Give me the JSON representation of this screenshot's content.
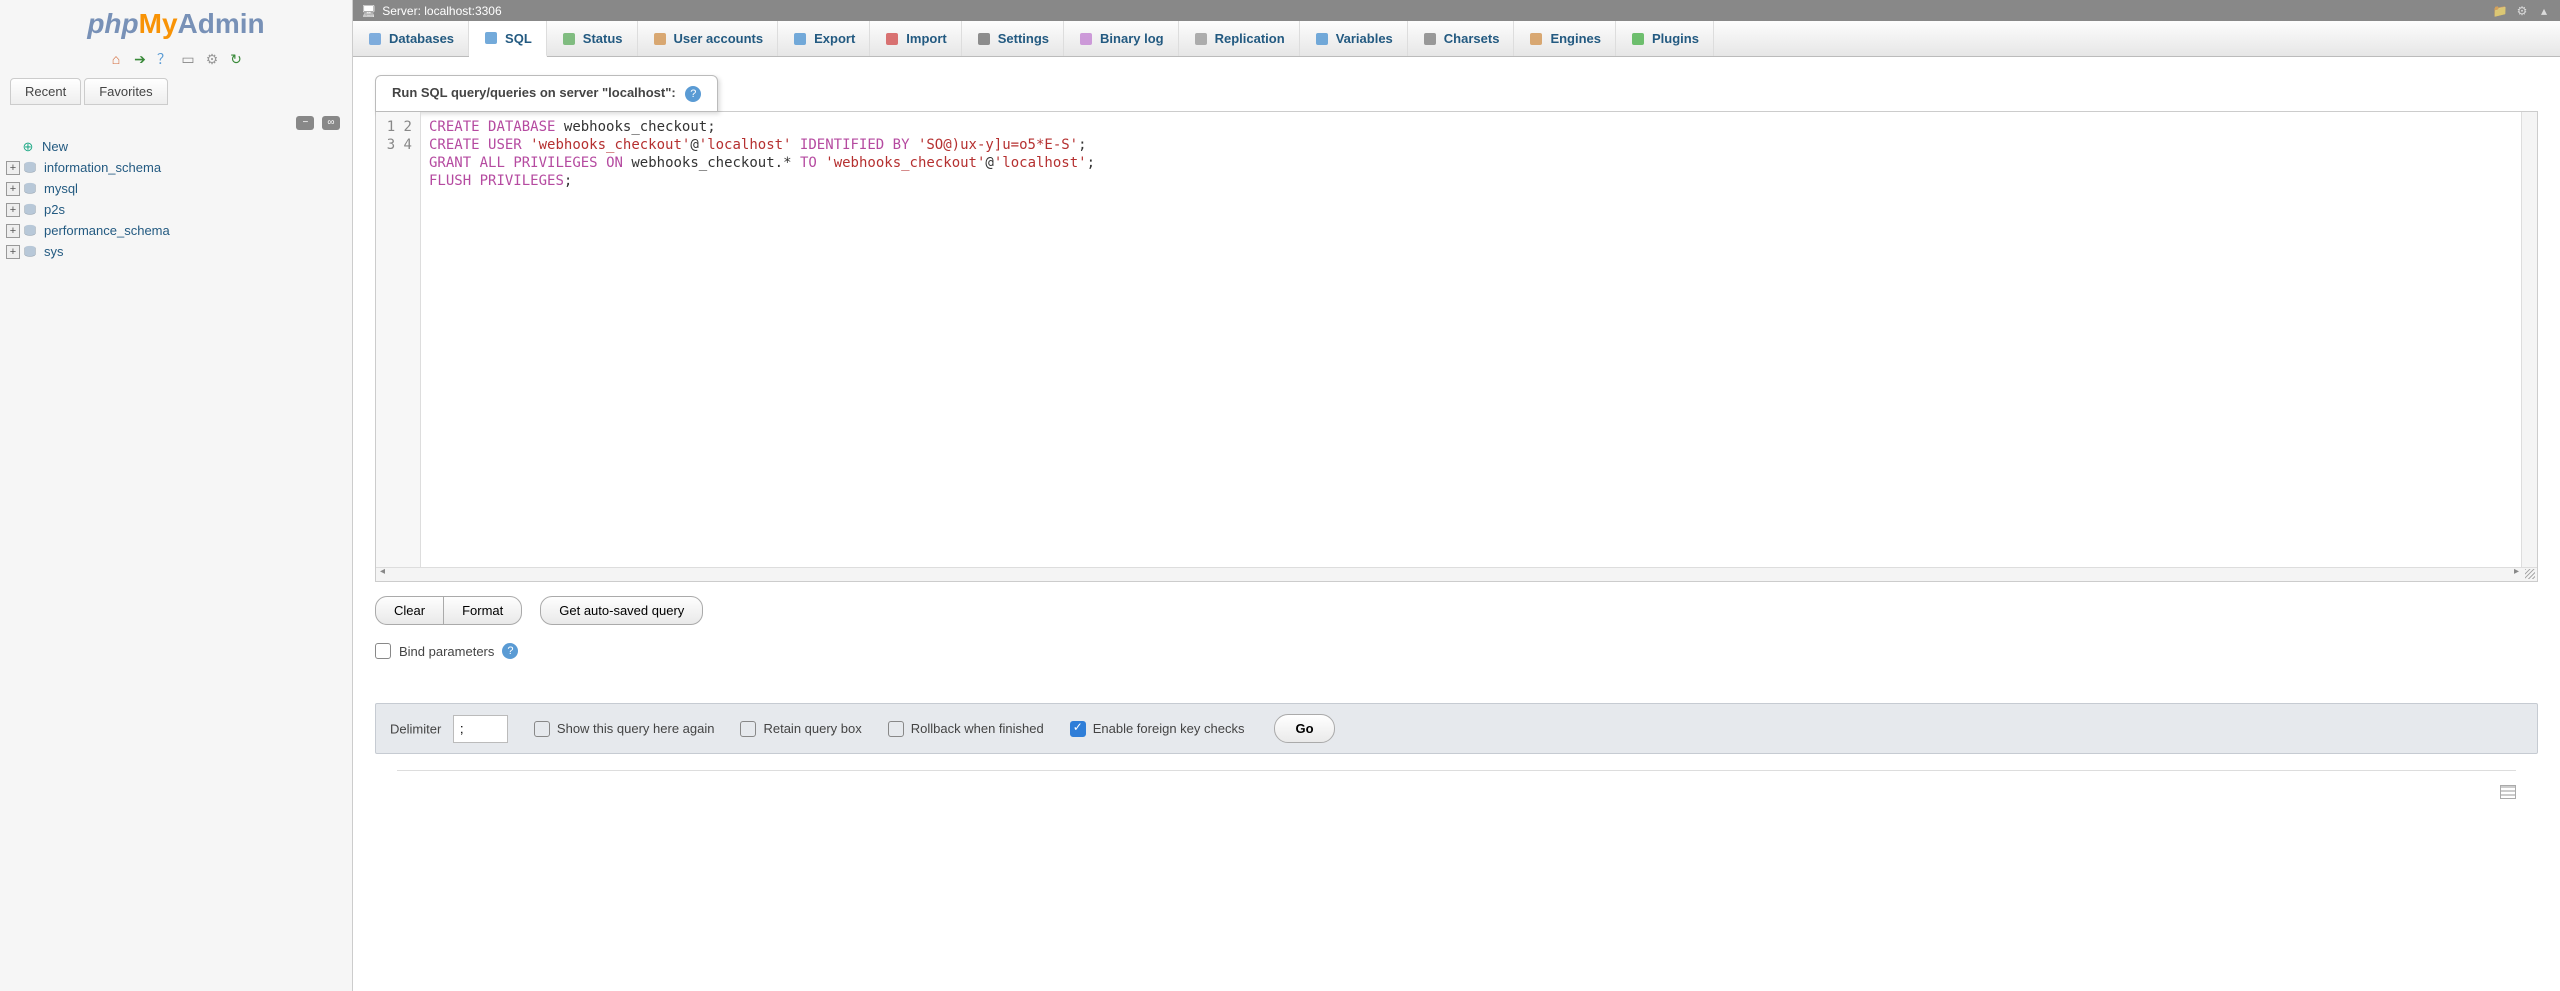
{
  "logo": {
    "php": "php",
    "my": "My",
    "admin": "Admin"
  },
  "sidebar": {
    "tabs": {
      "recent": "Recent",
      "favorites": "Favorites"
    },
    "new_label": "New",
    "databases": [
      "information_schema",
      "mysql",
      "p2s",
      "performance_schema",
      "sys"
    ]
  },
  "server_label": "Server: localhost:3306",
  "topnav": [
    {
      "label": "Databases",
      "id": "databases"
    },
    {
      "label": "SQL",
      "id": "sql",
      "active": true
    },
    {
      "label": "Status",
      "id": "status"
    },
    {
      "label": "User accounts",
      "id": "accounts"
    },
    {
      "label": "Export",
      "id": "export"
    },
    {
      "label": "Import",
      "id": "import"
    },
    {
      "label": "Settings",
      "id": "settings"
    },
    {
      "label": "Binary log",
      "id": "binlog"
    },
    {
      "label": "Replication",
      "id": "replication"
    },
    {
      "label": "Variables",
      "id": "variables"
    },
    {
      "label": "Charsets",
      "id": "charsets"
    },
    {
      "label": "Engines",
      "id": "engines"
    },
    {
      "label": "Plugins",
      "id": "plugins"
    }
  ],
  "panel_title": "Run SQL query/queries on server \"localhost\":",
  "sql_lines": [
    {
      "n": 1,
      "tokens": [
        [
          "kw",
          "CREATE"
        ],
        [
          "sp",
          " "
        ],
        [
          "kw",
          "DATABASE"
        ],
        [
          "sp",
          " "
        ],
        [
          "ident",
          "webhooks_checkout"
        ],
        [
          "p",
          ";"
        ]
      ]
    },
    {
      "n": 2,
      "tokens": [
        [
          "kw",
          "CREATE"
        ],
        [
          "sp",
          " "
        ],
        [
          "kw",
          "USER"
        ],
        [
          "sp",
          " "
        ],
        [
          "str",
          "'webhooks_checkout'"
        ],
        [
          "ident",
          "@"
        ],
        [
          "str",
          "'localhost'"
        ],
        [
          "sp",
          " "
        ],
        [
          "kw",
          "IDENTIFIED"
        ],
        [
          "sp",
          " "
        ],
        [
          "kw",
          "BY"
        ],
        [
          "sp",
          " "
        ],
        [
          "str",
          "'SO@)ux-y]u=o5*E-S'"
        ],
        [
          "p",
          ";"
        ]
      ]
    },
    {
      "n": 3,
      "tokens": [
        [
          "kw",
          "GRANT"
        ],
        [
          "sp",
          " "
        ],
        [
          "kw",
          "ALL"
        ],
        [
          "sp",
          " "
        ],
        [
          "kw",
          "PRIVILEGES"
        ],
        [
          "sp",
          " "
        ],
        [
          "kw",
          "ON"
        ],
        [
          "sp",
          " "
        ],
        [
          "ident",
          "webhooks_checkout"
        ],
        [
          "p",
          "."
        ],
        [
          "p",
          "*"
        ],
        [
          "sp",
          " "
        ],
        [
          "kw",
          "TO"
        ],
        [
          "sp",
          " "
        ],
        [
          "str",
          "'webhooks_checkout'"
        ],
        [
          "ident",
          "@"
        ],
        [
          "str",
          "'localhost'"
        ],
        [
          "p",
          ";"
        ]
      ]
    },
    {
      "n": 4,
      "tokens": [
        [
          "kw",
          "FLUSH"
        ],
        [
          "sp",
          " "
        ],
        [
          "kw",
          "PRIVILEGES"
        ],
        [
          "p",
          ";"
        ]
      ]
    }
  ],
  "buttons": {
    "clear": "Clear",
    "format": "Format",
    "autosave": "Get auto-saved query"
  },
  "bind_params": "Bind parameters",
  "footer": {
    "delimiter_label": "Delimiter",
    "delimiter_value": ";",
    "show_again": "Show this query here again",
    "retain": "Retain query box",
    "rollback": "Rollback when finished",
    "fk": "Enable foreign key checks",
    "go": "Go"
  },
  "nav_icons": {
    "databases": "#6aa0d8",
    "sql": "#5a9bd4",
    "status": "#6cb36c",
    "accounts": "#d49a5a",
    "export": "#5a9bd4",
    "import": "#d45a5a",
    "settings": "#7a7a7a",
    "binlog": "#c58ad4",
    "replication": "#a0a0a0",
    "variables": "#5a9bd4",
    "charsets": "#888",
    "engines": "#d49a5a",
    "plugins": "#56b556"
  }
}
